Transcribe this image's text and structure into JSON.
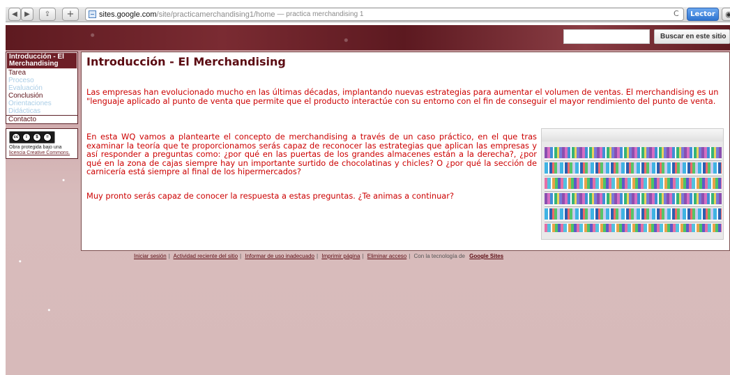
{
  "browser": {
    "url_domain": "sites.google.com",
    "url_path": "/site/practicamerchandising1/home",
    "url_title": "— practica merchandising 1",
    "reader_button": "Lector"
  },
  "header": {
    "search_button": "Buscar en este sitio"
  },
  "sidebar": {
    "items": [
      {
        "label": "Introducción - El Merchandising"
      },
      {
        "label": "Tarea"
      },
      {
        "label": "Proceso"
      },
      {
        "label": "Evaluación"
      },
      {
        "label": "Conclusión"
      },
      {
        "label": "Orientaciones Didácticas"
      },
      {
        "label": "Contacto"
      }
    ],
    "license_text": "Obra protegida bajo una",
    "license_link": "licencia Creative Commons."
  },
  "main": {
    "title": "Introducción - El Merchandising",
    "paragraph1": "Las empresas han evolucionado mucho en las últimas décadas, implantando nuevas estrategias para aumentar el volumen de ventas. El merchandising es un \"lenguaje aplicado al punto de venta que permite que el producto interactúe con su entorno con el fin de conseguir el mayor rendimiento del punto de venta.",
    "paragraph2": "En esta WQ vamos a plantearte el concepto de merchandising a través de un caso práctico, en el que tras examinar la teoría que te proporcionamos serás capaz de reconocer las estrategias que aplican las empresas y así responder a preguntas como: ¿por qué en las puertas de los grandes almacenes están a la derecha?, ¿por qué en la zona de cajas siempre hay un importante surtido de chocolatinas y chicles? O ¿por qué la sección de carnicería está siempre al final de los hipermercados?",
    "paragraph3": "Muy pronto serás capaz de conocer la respuesta a estas preguntas. ¿Te animas a continuar?"
  },
  "footer": {
    "links": [
      "Iniciar sesión",
      "Actividad reciente del sitio",
      "Informar de uso inadecuado",
      "Imprimir página",
      "Eliminar acceso"
    ],
    "powered_text": "Con la tecnología de",
    "brand": "Google Sites"
  }
}
